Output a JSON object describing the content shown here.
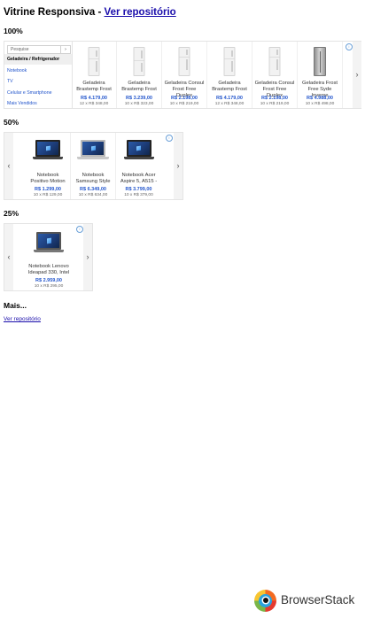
{
  "header": {
    "title": "Vitrine Responsiva - ",
    "repo_link": "Ver repositório"
  },
  "section_100": {
    "heading": "100%",
    "search_placeholder": "Pesquise",
    "search_button": "›",
    "menu": [
      {
        "label": "Geladeira / Refrigerador",
        "active": true
      },
      {
        "label": "Notebook",
        "active": false
      },
      {
        "label": "TV",
        "active": false
      },
      {
        "label": "Celular e Smartphone",
        "active": false
      },
      {
        "label": "Mais Vendidos",
        "active": false
      }
    ],
    "products": [
      {
        "name": "Geladeira Brastemp Frost",
        "price": "R$ 4.179,00",
        "installments": "12 x R$ 348,00",
        "image": "white-fridge-icon"
      },
      {
        "name": "Geladeira Brastemp Frost",
        "price": "R$ 3.239,00",
        "installments": "10 x R$ 323,00",
        "image": "white-fridge-icon"
      },
      {
        "name": "Geladeira Consul Frost Free Duplex",
        "price": "R$ 2.198,00",
        "installments": "10 x R$ 219,00",
        "image": "white-fridge-icon"
      },
      {
        "name": "Geladeira Brastemp Frost",
        "price": "R$ 4.179,00",
        "installments": "12 x R$ 348,00",
        "image": "white-fridge-icon"
      },
      {
        "name": "Geladeira Consul Frost Free Duplex",
        "price": "R$ 2.198,00",
        "installments": "10 x R$ 219,00",
        "image": "white-fridge-icon"
      },
      {
        "name": "Geladeira Frost Free Syde Inverse",
        "price": "R$ 4.988,00",
        "installments": "10 x R$ 498,00",
        "image": "steel-fridge-icon"
      }
    ],
    "next_arrow": "›",
    "ad_icon": "i"
  },
  "section_50": {
    "heading": "50%",
    "prev_arrow": "‹",
    "next_arrow": "›",
    "ad_icon": "i",
    "products": [
      {
        "name": "Notebook Positivo Motion",
        "price": "R$ 1.299,00",
        "installments": "10 x R$ 129,00",
        "image": "dark-laptop-icon"
      },
      {
        "name": "Notebook Samsung Style",
        "price": "R$ 6.349,00",
        "installments": "10 x R$ 634,00",
        "image": "silver-laptop-icon"
      },
      {
        "name": "Notebook Acer Aspire 5, A515 -",
        "price": "R$ 3.799,00",
        "installments": "10 x R$ 379,00",
        "image": "dark-laptop-icon"
      }
    ]
  },
  "section_25": {
    "heading": "25%",
    "prev_arrow": "‹",
    "next_arrow": "›",
    "ad_icon": "i",
    "products": [
      {
        "name": "Notebook Lenovo Ideapad 330, Intel",
        "price": "R$ 2.959,00",
        "installments": "10 x R$ 295,00",
        "image": "gray-laptop-icon"
      }
    ]
  },
  "more": {
    "heading": "Mais...",
    "link": "Ver repositório"
  },
  "footer": {
    "brand": "BrowserStack"
  },
  "colors": {
    "link": "#1a0dab",
    "price": "#2255cc",
    "menu_link": "#2255cc"
  }
}
